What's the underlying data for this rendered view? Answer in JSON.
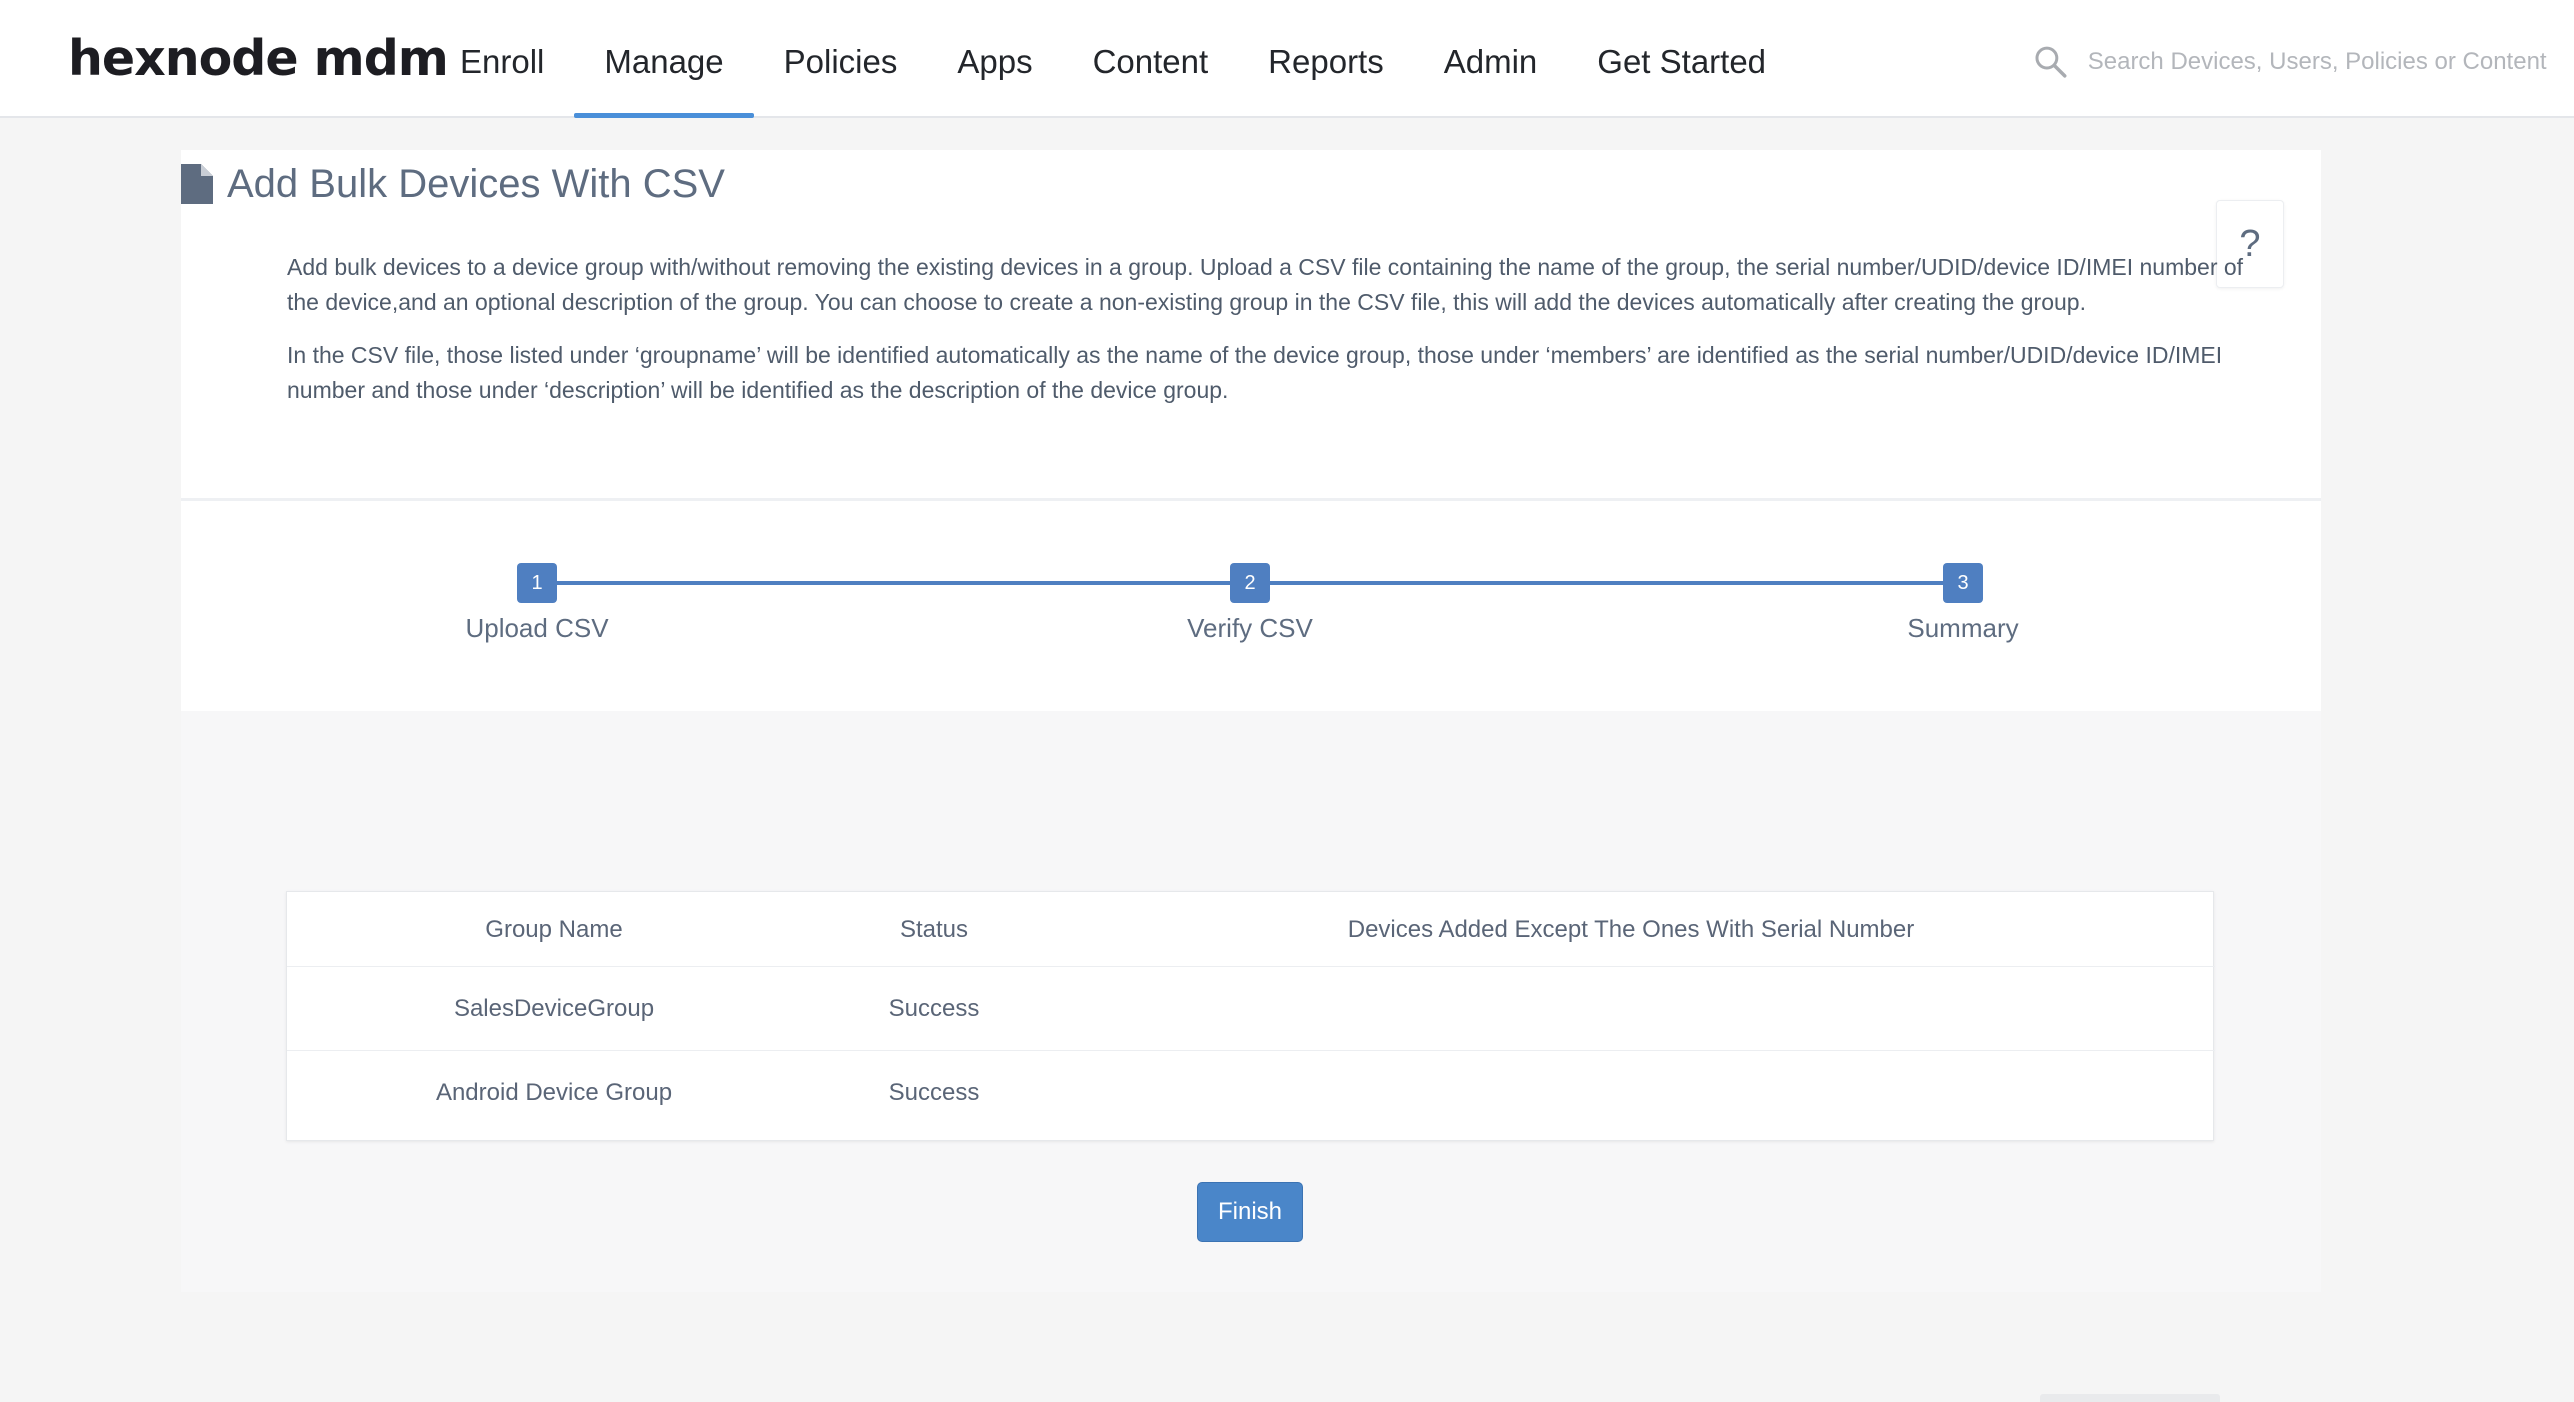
{
  "header": {
    "logo": "hexnode mdm",
    "nav": [
      "Enroll",
      "Manage",
      "Policies",
      "Apps",
      "Content",
      "Reports",
      "Admin",
      "Get Started"
    ],
    "active_nav": "Manage",
    "search_placeholder": "Search Devices, Users, Policies or Content"
  },
  "page": {
    "title": "Add Bulk Devices With CSV",
    "help": "?",
    "description": [
      "Add bulk devices to a device group with/without removing the existing devices in a group. Upload a CSV file containing the name of the group, the serial number/UDID/device ID/IMEI number of the device,and an optional description of the group. You can choose to create a non-existing group in the CSV file, this will add the devices automatically after creating the group.",
      "In the CSV file, those listed under ‘groupname’ will be identified automatically as the name of the device group, those under ‘members’ are identified as the serial number/UDID/device ID/IMEI number and those under ‘description’ will be identified as the description of the device group."
    ]
  },
  "steps": [
    {
      "num": "1",
      "label": "Upload CSV"
    },
    {
      "num": "2",
      "label": "Verify CSV"
    },
    {
      "num": "3",
      "label": "Summary"
    }
  ],
  "table": {
    "headers": [
      "Group Name",
      "Status",
      "Devices Added Except The Ones With Serial Number"
    ],
    "rows": [
      {
        "group": "SalesDeviceGroup",
        "status": "Success",
        "devices": ""
      },
      {
        "group": "Android Device Group",
        "status": "Success",
        "devices": ""
      }
    ]
  },
  "actions": {
    "finish": "Finish"
  }
}
